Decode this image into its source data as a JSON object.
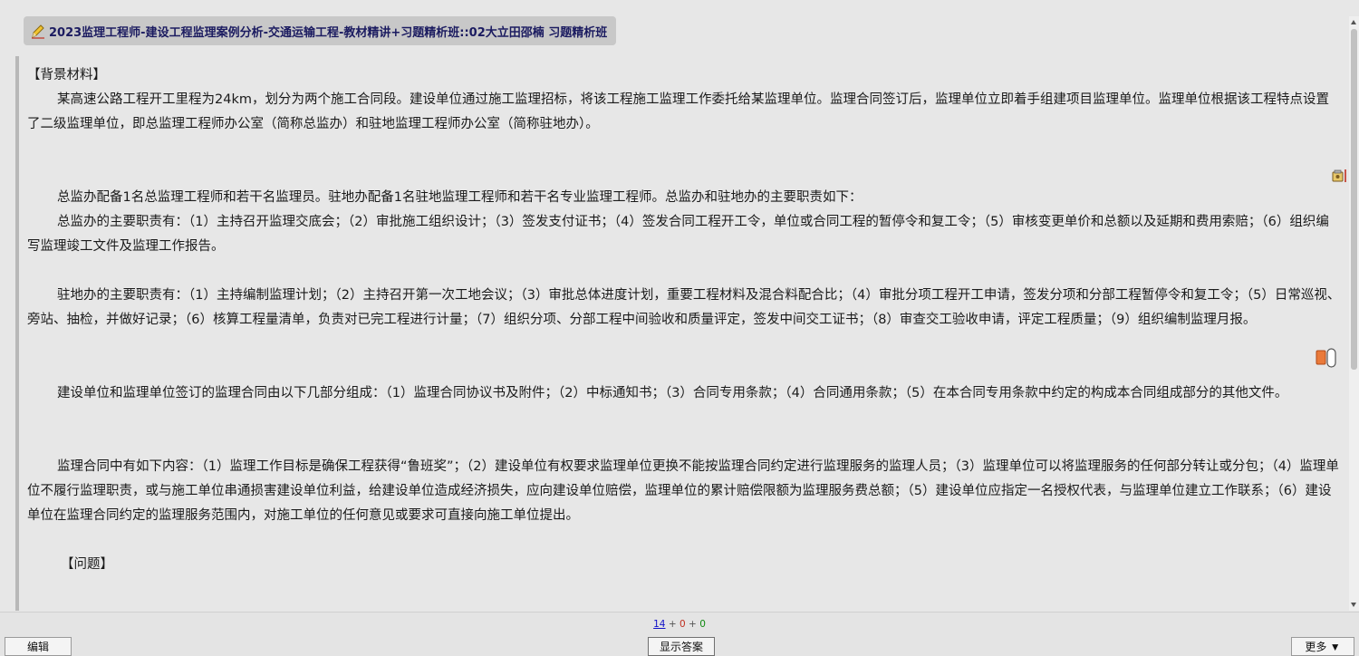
{
  "deck": {
    "title": "2023监理工程师-建设工程监理案例分析-交通运输工程-教材精讲+习题精析班::02大立田邵楠 习题精析班",
    "icon": "pencil-note-icon"
  },
  "card": {
    "heading_background": "【背景材料】",
    "paragraph_1": "某高速公路工程开工里程为24km，划分为两个施工合同段。建设单位通过施工监理招标，将该工程施工监理工作委托给某监理单位。监理合同签订后，监理单位立即着手组建项目监理单位。监理单位根据该工程特点设置了二级监理单位，即总监理工程师办公室（简称总监办）和驻地监理工程师办公室（简称驻地办）。",
    "paragraph_2": "总监办配备1名总监理工程师和若干名监理员。驻地办配备1名驻地监理工程师和若干名专业监理工程师。总监办和驻地办的主要职责如下：",
    "paragraph_3": "总监办的主要职责有：（1）主持召开监理交底会；（2）审批施工组织设计；（3）签发支付证书；（4）签发合同工程开工令，单位或合同工程的暂停令和复工令；（5）审核变更单价和总额以及延期和费用索赔；（6）组织编写监理竣工文件及监理工作报告。",
    "paragraph_4": "驻地办的主要职责有：（1）主持编制监理计划；（2）主持召开第一次工地会议；（3）审批总体进度计划，重要工程材料及混合料配合比；（4）审批分项工程开工申请，签发分项和分部工程暂停令和复工令；（5）日常巡视、旁站、抽检，并做好记录；（6）核算工程量清单，负责对已完工程进行计量；（7）组织分项、分部工程中间验收和质量评定，签发中间交工证书；（8）审查交工验收申请，评定工程质量；（9）组织编制监理月报。",
    "paragraph_5": "建设单位和监理单位签订的监理合同由以下几部分组成：（1）监理合同协议书及附件；（2）中标通知书；（3）合同专用条款；（4）合同通用条款；（5）在本合同专用条款中约定的构成本合同组成部分的其他文件。",
    "paragraph_6": "监理合同中有如下内容：（1）监理工作目标是确保工程获得“鲁班奖”；（2）建设单位有权要求监理单位更换不能按监理合同约定进行监理服务的监理人员；（3）监理单位可以将监理服务的任何部分转让或分包；（4）监理单位不履行监理职责，或与施工单位串通损害建设单位利益，给建设单位造成经济损失，应向建设单位赔偿，监理单位的累计赔偿限额为监理服务费总额；（5）建设单位应指定一名授权代表，与监理单位建立工作联系；（6）建设单位在监理合同约定的监理服务范围内，对施工单位的任何意见或要求可直接向施工单位提出。",
    "heading_question": "【问题】"
  },
  "counts": {
    "new": "14",
    "learning": "0",
    "review": "0",
    "separator": "+"
  },
  "buttons": {
    "edit": "编辑",
    "show_answer": "显示答案",
    "more": "更多 ▼"
  },
  "colors": {
    "background": "#e7e7e7",
    "title_bar": "#c8c8c8",
    "new_count": "#1010c8",
    "learning_count": "#c03020",
    "review_count": "#108a10"
  }
}
